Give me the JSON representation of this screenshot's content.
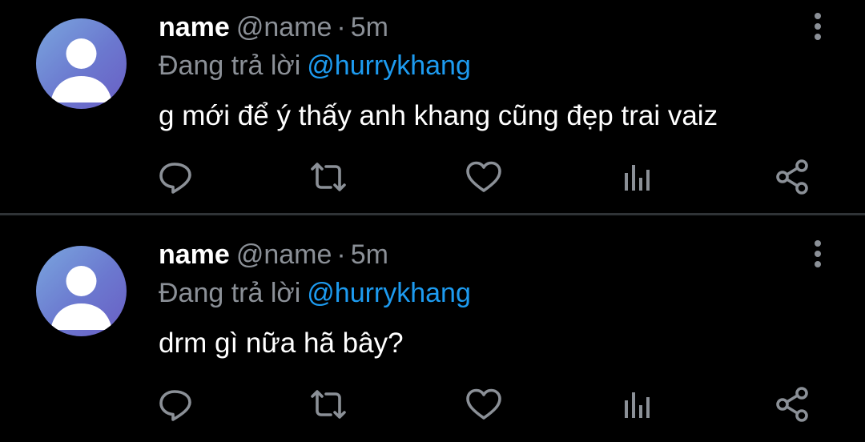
{
  "colors": {
    "background": "#000000",
    "text_primary": "#ffffff",
    "text_secondary": "#8b9097",
    "mention": "#1d9bf0",
    "divider": "#2f3336",
    "icon": "#8b9097"
  },
  "icons": {
    "avatar": "default-profile-icon",
    "more": "more-vertical-icon",
    "reply": "reply-icon",
    "retweet": "retweet-icon",
    "like": "heart-icon",
    "stats": "analytics-icon",
    "share": "share-icon"
  },
  "tweets": [
    {
      "display_name": "name",
      "handle": "@name",
      "separator": "·",
      "time": "5m",
      "reply_prefix": "Đang trả lời",
      "reply_to": "@hurrykhang",
      "text": "g mới để ý thấy anh khang cũng đẹp trai vaiz"
    },
    {
      "display_name": "name",
      "handle": "@name",
      "separator": "·",
      "time": "5m",
      "reply_prefix": "Đang trả lời",
      "reply_to": "@hurrykhang",
      "text": "drm gì nữa hã bây?"
    }
  ]
}
